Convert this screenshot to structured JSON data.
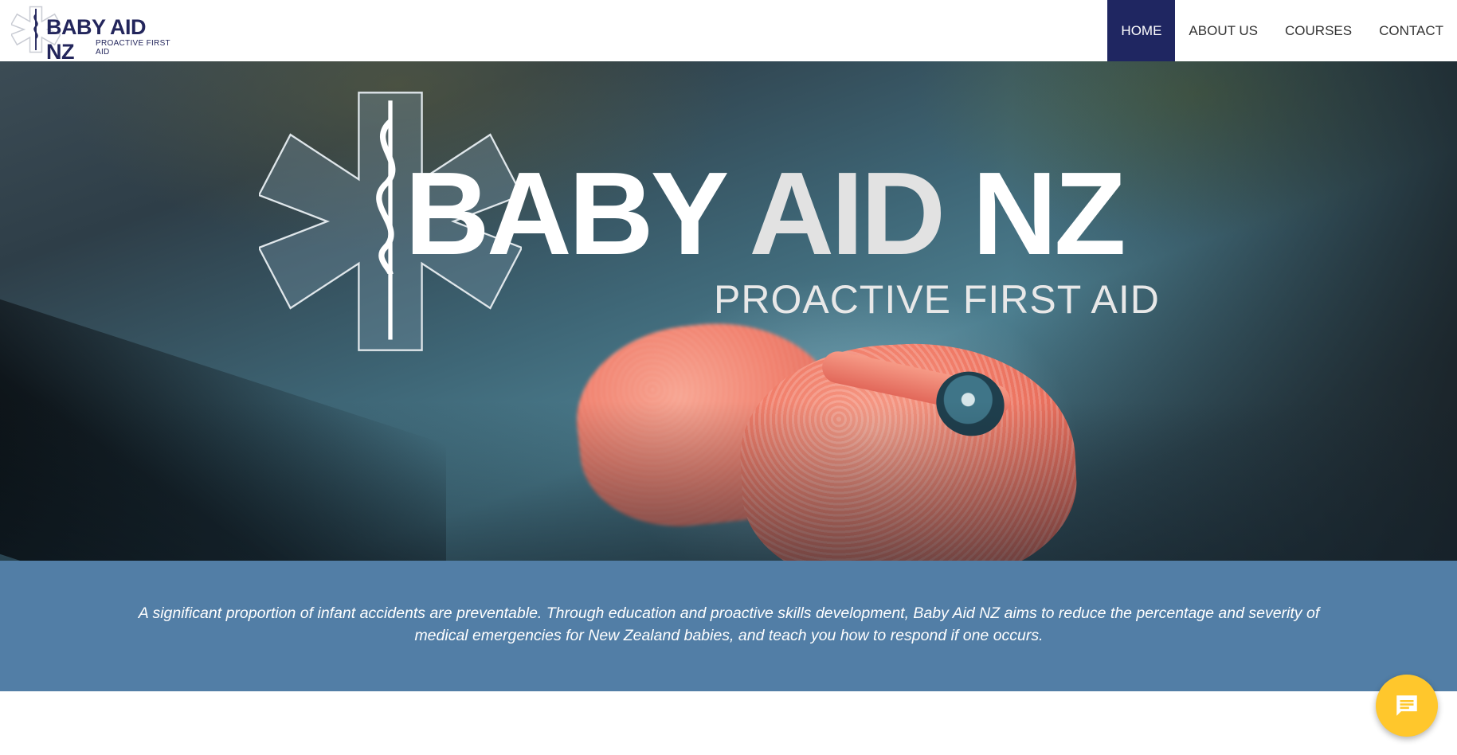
{
  "header": {
    "logo": {
      "title": "BABY AID NZ",
      "subtitle": "PROACTIVE FIRST AID"
    },
    "nav": [
      {
        "label": "HOME",
        "active": true
      },
      {
        "label": "ABOUT US",
        "active": false
      },
      {
        "label": "COURSES",
        "active": false
      },
      {
        "label": "CONTACT",
        "active": false
      }
    ]
  },
  "hero": {
    "title_part1": "BABY",
    "title_part2": "AID",
    "title_part3": "NZ",
    "subtitle": "PROACTIVE FIRST AID",
    "background": "knitted coral baby booties on wooden surface"
  },
  "banner": {
    "text": "A significant proportion of infant accidents are preventable. Through education and proactive skills development, Baby Aid NZ aims to reduce the percentage and severity of medical emergencies for New Zealand babies, and teach you how to respond if one occurs."
  },
  "chat": {
    "icon": "chat-bubble-icon"
  },
  "colors": {
    "brand_navy": "#1f2661",
    "banner_blue": "#527ea6",
    "chat_yellow": "#ffc72c"
  }
}
